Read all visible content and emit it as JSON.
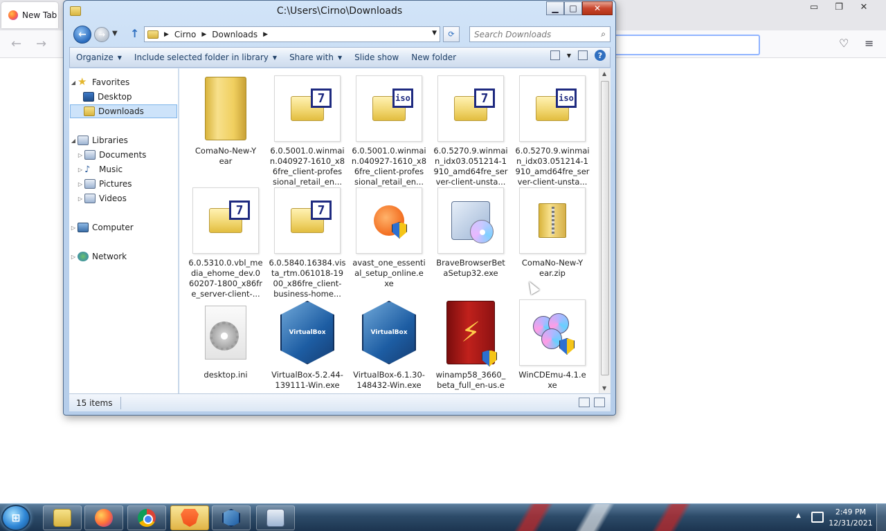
{
  "firefox": {
    "tab_title": "New Tab",
    "nav": {
      "back": "←",
      "forward": "→"
    },
    "controls": {
      "minimize": "▭",
      "restore": "❐",
      "close": "✕"
    },
    "right_icons": {
      "pocket": "♡",
      "menu": "≡"
    }
  },
  "explorer": {
    "title": "C:\\Users\\Cirno\\Downloads",
    "controls": {
      "minimize": "▁",
      "maximize": "□",
      "close": "✕"
    },
    "nav": {
      "back": "←",
      "forward": "→",
      "up": "↑",
      "refresh": "⟳",
      "dropdown": "▼"
    },
    "breadcrumb": [
      "Cirno",
      "Downloads"
    ],
    "search": {
      "placeholder": "Search Downloads"
    },
    "commands": [
      "Organize",
      "Include selected folder in library",
      "Share with",
      "Slide show",
      "New folder"
    ],
    "help": "?",
    "sidebar": {
      "favorites": {
        "label": "Favorites",
        "items": [
          "Desktop",
          "Downloads"
        ]
      },
      "libraries": {
        "label": "Libraries",
        "items": [
          "Documents",
          "Music",
          "Pictures",
          "Videos"
        ]
      },
      "computer": "Computer",
      "network": "Network"
    },
    "files": [
      {
        "name": "ComaNo-New-Year",
        "display": "ComaNo-New-Y\near",
        "type": "folder"
      },
      {
        "name": "6.0.5001.0.winmain.040927-1610_x86fre_client-professional_retail_en...",
        "display": "6.0.5001.0.winmai\nn.040927-1610_x8\n6fre_client-profes\nsional_retail_en...",
        "type": "7z"
      },
      {
        "name": "6.0.5001.0.winmain.040927-1610_x86fre_client-professional_retail_en...",
        "display": "6.0.5001.0.winmai\nn.040927-1610_x8\n6fre_client-profes\nsional_retail_en...",
        "type": "iso"
      },
      {
        "name": "6.0.5270.9.winmain_idx03.051214-1910_amd64fre_server-client-unsta...",
        "display": "6.0.5270.9.winmai\nn_idx03.051214-1\n910_amd64fre_ser\nver-client-unsta...",
        "type": "7z"
      },
      {
        "name": "6.0.5270.9.winmain_idx03.051214-1910_amd64fre_server-client-unsta...",
        "display": "6.0.5270.9.winmai\nn_idx03.051214-1\n910_amd64fre_ser\nver-client-unsta...",
        "type": "iso"
      },
      {
        "name": "6.0.5310.0.vbl_media_ehome_dev.060207-1800_x86fre_server-client-...",
        "display": "6.0.5310.0.vbl_me\ndia_ehome_dev.0\n60207-1800_x86fr\ne_server-client-...",
        "type": "7z"
      },
      {
        "name": "6.0.5840.16384.vista_rtm.061018-1900_x86fre_client-business-home...",
        "display": "6.0.5840.16384.vis\nta_rtm.061018-19\n00_x86fre_client-\nbusiness-home...",
        "type": "7z"
      },
      {
        "name": "avast_one_essential_setup_online.exe",
        "display": "avast_one_essenti\nal_setup_online.e\nxe",
        "type": "avast"
      },
      {
        "name": "BraveBrowserBetaSetup32.exe",
        "display": "BraveBrowserBet\naSetup32.exe",
        "type": "setup"
      },
      {
        "name": "ComaNo-New-Year.zip",
        "display": "ComaNo-New-Y\near.zip",
        "type": "zip"
      },
      {
        "name": "desktop.ini",
        "display": "desktop.ini",
        "type": "ini"
      },
      {
        "name": "VirtualBox-5.2.44-139111-Win.exe",
        "display": "VirtualBox-5.2.44-\n139111-Win.exe",
        "type": "vbox"
      },
      {
        "name": "VirtualBox-6.1.30-148432-Win.exe",
        "display": "VirtualBox-6.1.30-\n148432-Win.exe",
        "type": "vbox"
      },
      {
        "name": "winamp58_3660_beta_full_en-us.exe",
        "display": "winamp58_3660_\nbeta_full_en-us.e\nxe",
        "type": "winamp"
      },
      {
        "name": "WinCDEmu-4.1.exe",
        "display": "WinCDEmu-4.1.e\nxe",
        "type": "wincd"
      }
    ],
    "status": {
      "count": "15 items"
    }
  },
  "taskbar": {
    "start": "⊞",
    "buttons": [
      {
        "icon": "explorer-folder-icon"
      },
      {
        "icon": "firefox-icon"
      },
      {
        "icon": "chrome-icon"
      },
      {
        "icon": "brave-beta-icon",
        "active": true
      },
      {
        "icon": "virtualbox-icon"
      },
      {
        "icon": "resource-monitor-icon"
      }
    ],
    "clock": {
      "time": "2:49 PM",
      "date": "12/31/2021"
    },
    "tray_arrow": "▲"
  },
  "colors": {
    "explorer_frame": "#bcd3ee",
    "selection": "#cde3fa",
    "taskbar": "#2d4b69",
    "close_red": "#c8452d"
  }
}
